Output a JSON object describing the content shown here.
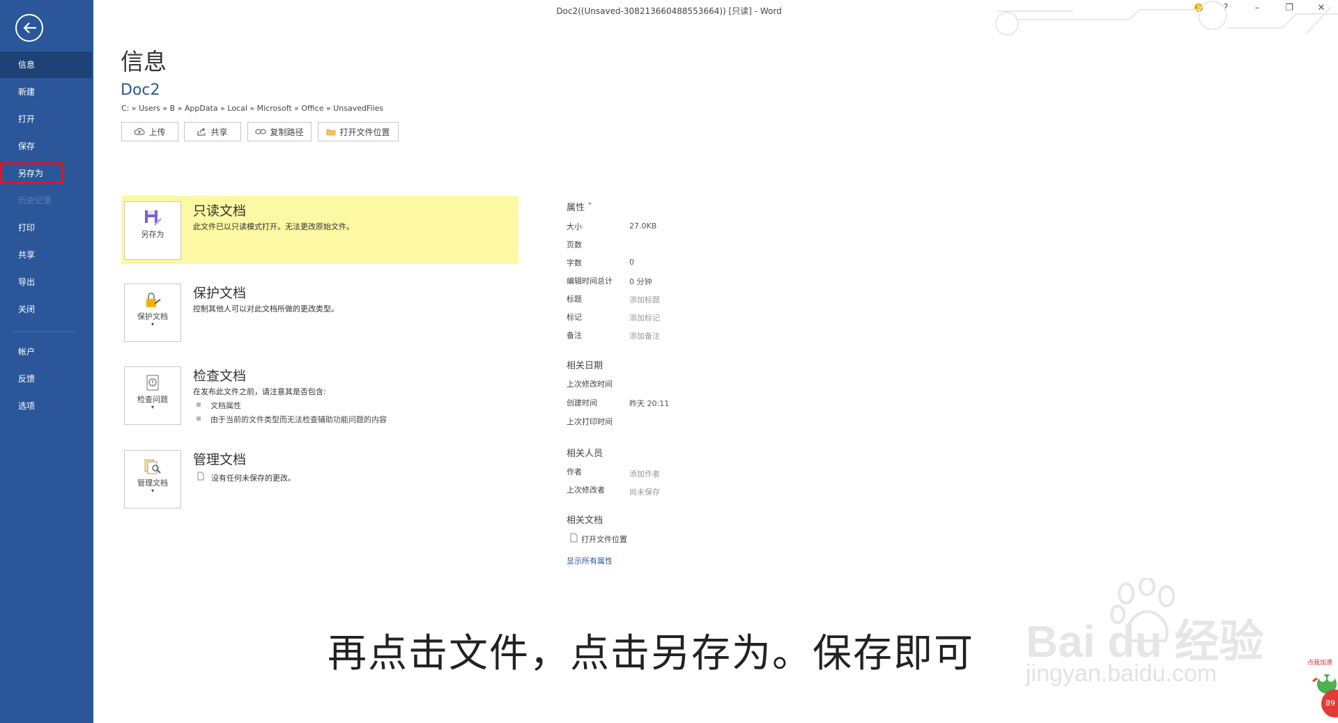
{
  "titlebar": {
    "title": "Doc2((Unsaved-308213660488553664)) [只读] - Word",
    "help": "?",
    "minimize": "–",
    "restore": "❐",
    "close": "✕"
  },
  "sidebar": {
    "items": [
      {
        "label": "信息"
      },
      {
        "label": "新建"
      },
      {
        "label": "打开"
      },
      {
        "label": "保存"
      },
      {
        "label": "另存为"
      },
      {
        "label": "历史记录"
      },
      {
        "label": "打印"
      },
      {
        "label": "共享"
      },
      {
        "label": "导出"
      },
      {
        "label": "关闭"
      },
      {
        "label": "帐户"
      },
      {
        "label": "反馈"
      },
      {
        "label": "选项"
      }
    ]
  },
  "header": {
    "page_title": "信息",
    "doc_name": "Doc2",
    "path": "C: » Users » B » AppData » Local » Microsoft » Office » UnsavedFiles"
  },
  "toolbar": {
    "upload": "上传",
    "share": "共享",
    "copy_path": "复制路径",
    "open_location": "打开文件位置"
  },
  "sections": {
    "readonly": {
      "card": "另存为",
      "title": "只读文档",
      "desc": "此文件已以只读模式打开。无法更改原始文件。"
    },
    "protect": {
      "card": "保护文档",
      "title": "保护文档",
      "desc": "控制其他人可以对此文档所做的更改类型。"
    },
    "inspect": {
      "card": "检查问题",
      "title": "检查文档",
      "desc": "在发布此文件之前，请注意其是否包含:",
      "bullets": [
        "文档属性",
        "由于当前的文件类型而无法检查辅助功能问题的内容"
      ]
    },
    "manage": {
      "card": "管理文档",
      "title": "管理文档",
      "desc": "没有任何未保存的更改。"
    }
  },
  "properties": {
    "heading": "属性 ˇ",
    "rows": [
      {
        "label": "大小",
        "value": "27.0KB"
      },
      {
        "label": "页数",
        "value": ""
      },
      {
        "label": "字数",
        "value": "0"
      },
      {
        "label": "编辑时间总计",
        "value": "0 分钟"
      },
      {
        "label": "标题",
        "value": "添加标题"
      },
      {
        "label": "标记",
        "value": "添加标记"
      },
      {
        "label": "备注",
        "value": "添加备注"
      }
    ],
    "dates_heading": "相关日期",
    "dates": [
      {
        "label": "上次修改时间",
        "value": ""
      },
      {
        "label": "创建时间",
        "value": "昨天 20:11"
      },
      {
        "label": "上次打印时间",
        "value": ""
      }
    ],
    "people_heading": "相关人员",
    "people": [
      {
        "label": "作者",
        "value": "添加作者"
      },
      {
        "label": "上次修改者",
        "value": "尚未保存"
      }
    ],
    "docs_heading": "相关文档",
    "open_location": "打开文件位置",
    "show_all": "显示所有属性"
  },
  "overlay": {
    "subtitle": "再点击文件，点击另存为。保存即可",
    "watermark_brand": "Bai du 经验",
    "watermark_url": "jingyan.baidu.com",
    "badge_text": "89",
    "badge_label": "点我加速"
  },
  "colors": {
    "sidebar": "#2b579a",
    "sidebar_active": "#1e4275",
    "highlight_box": "#e81123",
    "readonly_bg": "#fcf8a3",
    "link": "#2b579a"
  }
}
